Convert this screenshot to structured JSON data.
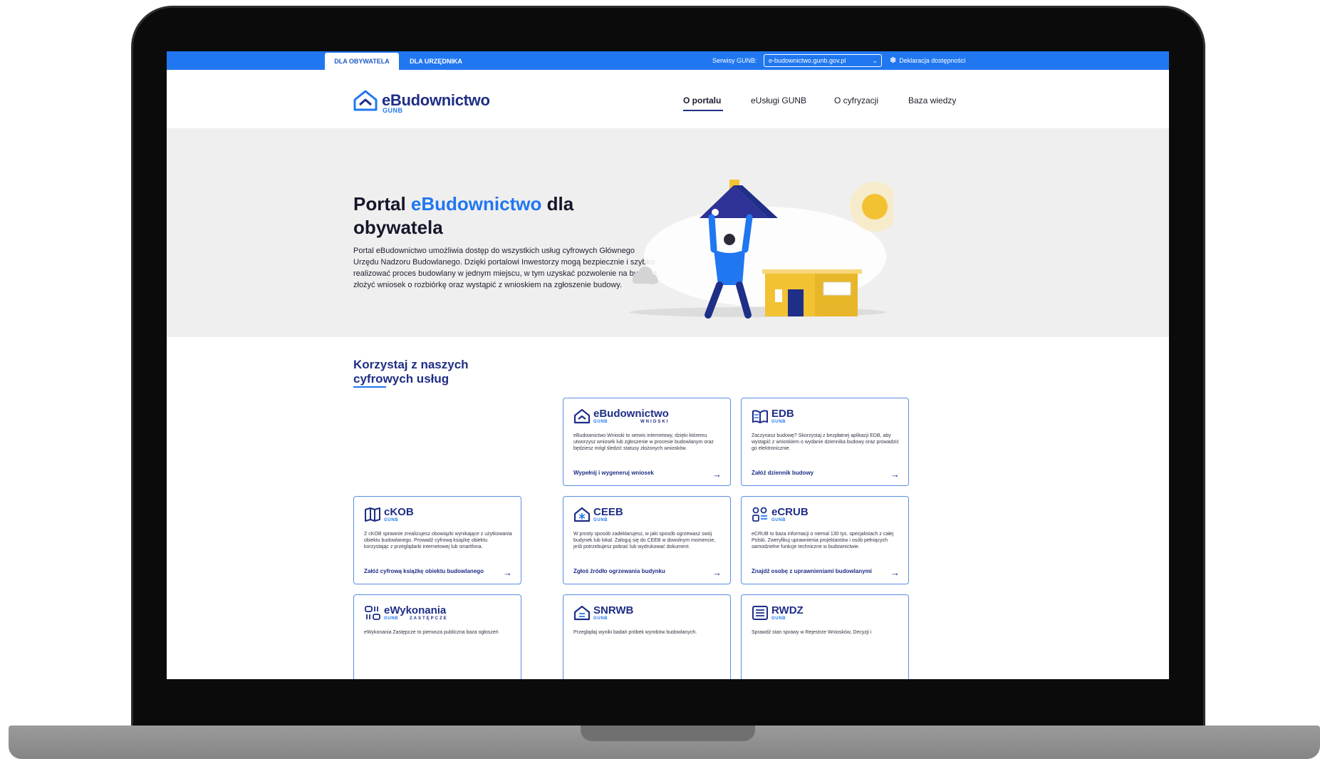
{
  "topbar": {
    "tabs": [
      {
        "label": "DLA OBYWATELA",
        "active": true
      },
      {
        "label": "DLA URZĘDNIKA",
        "active": false
      }
    ],
    "gunb_label": "Serwisy GUNB:",
    "gunb_select_value": "e-budownictwo.gunb.gov.pl",
    "accessibility_label": "Deklaracja dostępności"
  },
  "header": {
    "logo_name": "eBudownictwo",
    "logo_sub": "GUNB",
    "nav": [
      {
        "label": "O portalu",
        "active": true
      },
      {
        "label": "eUsługi GUNB",
        "active": false
      },
      {
        "label": "O cyfryzacji",
        "active": false
      },
      {
        "label": "Baza wiedzy",
        "active": false
      }
    ]
  },
  "hero": {
    "title_prefix": "Portal ",
    "title_accent": "eBudownictwo",
    "title_suffix": " dla obywatela",
    "description": "Portal eBudownictwo umożliwia dostęp do wszystkich usług cyfrowych Głównego Urzędu Nadzoru Budowlanego. Dzięki portalowi Inwestorzy mogą bezpiecznie i szybko realizować proces budowlany w jednym miejscu, w tym uzyskać pozwolenie na budowę, złożyć wniosek o rozbiórkę oraz wystąpić z wnioskiem na zgłoszenie budowy."
  },
  "services": {
    "heading": "Korzystaj z naszych cyfrowych usług",
    "cards": [
      {
        "name": "eBudownictwo",
        "sub": "GUNB",
        "sub2": "WNIOSKI",
        "icon": "house-icon",
        "description": "eBudownictwo Wnioski to serwis internetowy, dzięki któremu utworzysz wniosek lub zgłoszenie w procesie budowlanym oraz będziesz mógł śledzić statusy złożonych wniosków.",
        "link": "Wypełnij i wygeneruj wniosek"
      },
      {
        "name": "EDB",
        "sub": "GUNB",
        "sub2": "",
        "icon": "open-book-icon",
        "description": "Zaczynasz budowę? Skorzystaj z bezpłatnej aplikacji EDB, aby wystąpić z wnioskiem o wydanie dziennika budowy oraz prowadzić go elektronicznie.",
        "link": "Załóż dziennik budowy"
      },
      {
        "name": "cKOB",
        "sub": "GUNB",
        "sub2": "",
        "icon": "book-icon",
        "description": "Z cKOB sprawnie zrealizujesz obowiązki wynikające z użytkowania obiektu budowlanego. Prowadź cyfrową książkę obiektu korzystając z przeglądarki internetowej lub smartfona.",
        "link": "Załóż cyfrową książkę obiektu budowlanego"
      },
      {
        "name": "CEEB",
        "sub": "GUNB",
        "sub2": "",
        "icon": "snowflake-house-icon",
        "description": "W prosty sposób zadeklarujesz, w jaki sposób ogrzewasz swój budynek lub lokal. Zaloguj się do CEEB w dowolnym momencie, jeśli potrzebujesz pobrać lub wydrukować dokument.",
        "link": "Zgłoś źródło ogrzewania budynku"
      },
      {
        "name": "eCRUB",
        "sub": "GUNB",
        "sub2": "",
        "icon": "people-list-icon",
        "description": "eCRUB to baza informacji o niemal 130 tys. specjalistach z całej Polski. Zweryfikuj uprawnienia projektantów i osób pełniących samodzielne funkcje techniczne w budownictwie.",
        "link": "Znajdź osobę z uprawnieniami budowlanymi"
      },
      {
        "name": "eWykonania",
        "sub": "GUNB",
        "sub2": "ZASTĘPCZE",
        "icon": "blocks-icon",
        "description": "eWykonania Zastępcze to pierwsza publiczna baza ogłoszeń",
        "link": ""
      },
      {
        "name": "SNRWB",
        "sub": "GUNB",
        "sub2": "",
        "icon": "house-list-icon",
        "description": "Przeglądaj wyniki badań próbek wyrobów budowlanych.",
        "link": ""
      },
      {
        "name": "RWDZ",
        "sub": "GUNB",
        "sub2": "",
        "icon": "document-list-icon",
        "description": "Sprawdź stan sprawy w Rejestrze Wniosków, Decyzji i",
        "link": ""
      }
    ]
  },
  "colors": {
    "brand_blue": "#2077f0",
    "navy": "#1f2e86",
    "hero_bg": "#efefef",
    "house_yellow": "#f2c232"
  }
}
